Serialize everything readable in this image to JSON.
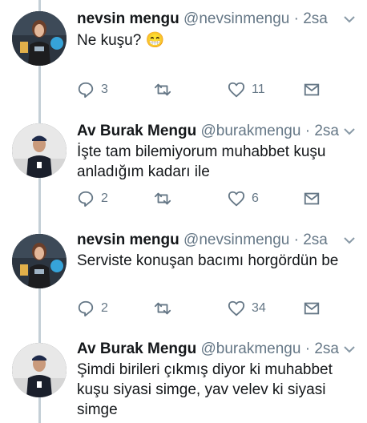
{
  "tweets": [
    {
      "name": "nevsin mengu",
      "handle": "@nevsinmengu",
      "dot": "·",
      "time": "2sa",
      "text": "Ne kuşu?",
      "emoji": "😁",
      "replies": "3",
      "retweets": "",
      "likes": "11",
      "avatar_icon": "woman-presenter-avatar",
      "avatar_bg": "#2c3540"
    },
    {
      "name": "Av Burak Mengu",
      "handle": "@burakmengu",
      "dot": "·",
      "time": "2sa",
      "text": "İşte tam bilemiyorum muhabbet kuşu anladığım kadarı ile",
      "replies": "2",
      "retweets": "",
      "likes": "6",
      "avatar_icon": "man-cap-avatar",
      "avatar_bg": "#e8e8e8"
    },
    {
      "name": "nevsin mengu",
      "handle": "@nevsinmengu",
      "dot": "·",
      "time": "2sa",
      "text": "Serviste konuşan bacımı horgördün be",
      "replies": "2",
      "retweets": "",
      "likes": "34",
      "avatar_icon": "woman-presenter-avatar",
      "avatar_bg": "#2c3540"
    },
    {
      "name": "Av Burak Mengu",
      "handle": "@burakmengu",
      "dot": "·",
      "time": "2sa",
      "text": "Şimdi birileri çıkmış diyor ki muhabbet kuşu siyasi simge, yav velev ki siyasi simge",
      "avatar_icon": "man-cap-avatar",
      "avatar_bg": "#e8e8e8"
    }
  ],
  "colors": {
    "text": "#14171a",
    "secondary": "#657786",
    "thread_line": "#c4cfd6"
  }
}
